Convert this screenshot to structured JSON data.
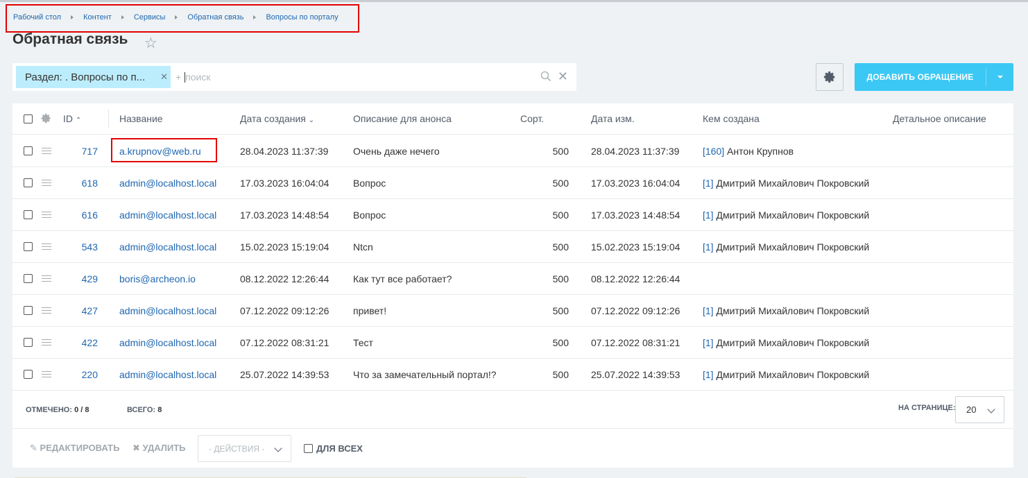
{
  "breadcrumb": [
    "Рабочий стол",
    "Контент",
    "Сервисы",
    "Обратная связь",
    "Вопросы по порталу"
  ],
  "page_title": "Обратная связь",
  "filter": {
    "tag_label": "Раздел: . Вопросы по п...",
    "plus": "+",
    "placeholder": "поиск"
  },
  "add_button": "ДОБАВИТЬ ОБРАЩЕНИЕ",
  "columns": {
    "id": "ID",
    "name": "Название",
    "created": "Дата создания",
    "preview": "Описание для анонса",
    "sort": "Сорт.",
    "modified": "Дата изм.",
    "created_by": "Кем создана",
    "detail": "Детальное описание"
  },
  "rows": [
    {
      "id": "717",
      "name": "a.krupnov@web.ru",
      "created": "28.04.2023 11:37:39",
      "preview": "Очень даже нечего",
      "sort": "500",
      "modified": "28.04.2023 11:37:39",
      "user_id": "[160]",
      "user_name": "Антон Крупнов"
    },
    {
      "id": "618",
      "name": "admin@localhost.local",
      "created": "17.03.2023 16:04:04",
      "preview": "Вопрос",
      "sort": "500",
      "modified": "17.03.2023 16:04:04",
      "user_id": "[1]",
      "user_name": "Дмитрий Михайлович Покровский"
    },
    {
      "id": "616",
      "name": "admin@localhost.local",
      "created": "17.03.2023 14:48:54",
      "preview": "Вопрос",
      "sort": "500",
      "modified": "17.03.2023 14:48:54",
      "user_id": "[1]",
      "user_name": "Дмитрий Михайлович Покровский"
    },
    {
      "id": "543",
      "name": "admin@localhost.local",
      "created": "15.02.2023 15:19:04",
      "preview": "Ntcn",
      "sort": "500",
      "modified": "15.02.2023 15:19:04",
      "user_id": "[1]",
      "user_name": "Дмитрий Михайлович Покровский"
    },
    {
      "id": "429",
      "name": "boris@archeon.io",
      "created": "08.12.2022 12:26:44",
      "preview": "Как тут все работает?",
      "sort": "500",
      "modified": "08.12.2022 12:26:44",
      "user_id": "",
      "user_name": ""
    },
    {
      "id": "427",
      "name": "admin@localhost.local",
      "created": "07.12.2022 09:12:26",
      "preview": "привет!",
      "sort": "500",
      "modified": "07.12.2022 09:12:26",
      "user_id": "[1]",
      "user_name": "Дмитрий Михайлович Покровский"
    },
    {
      "id": "422",
      "name": "admin@localhost.local",
      "created": "07.12.2022 08:31:21",
      "preview": "Тест",
      "sort": "500",
      "modified": "07.12.2022 08:31:21",
      "user_id": "[1]",
      "user_name": "Дмитрий Михайлович Покровский"
    },
    {
      "id": "220",
      "name": "admin@localhost.local",
      "created": "25.07.2022 14:39:53",
      "preview": "Что за замечательный портал!?",
      "sort": "500",
      "modified": "25.07.2022 14:39:53",
      "user_id": "[1]",
      "user_name": "Дмитрий Михайлович Покровский"
    }
  ],
  "footer": {
    "selected_label": "ОТМЕЧЕНО:",
    "selected_value": "0 / 8",
    "total_label": "ВСЕГО:",
    "total_value": "8",
    "per_page_label": "НА СТРАНИЦЕ:",
    "per_page_value": "20"
  },
  "actions": {
    "edit": "РЕДАКТИРОВАТЬ",
    "delete": "УДАЛИТЬ",
    "actions_select": "- ДЕЙСТВИЯ -",
    "for_all": "ДЛЯ ВСЕХ"
  },
  "colors": {
    "accent": "#3bc8f5",
    "link": "#2067b0",
    "highlight": "#e30000",
    "filter_tag": "#bcedfc"
  }
}
